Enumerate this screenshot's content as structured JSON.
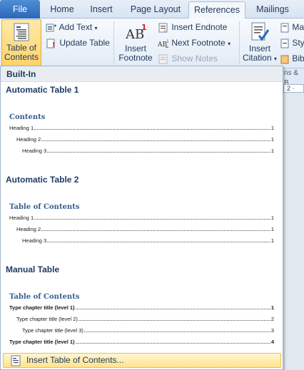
{
  "tabs": {
    "file": "File",
    "home": "Home",
    "insert": "Insert",
    "page_layout": "Page Layout",
    "references": "References",
    "mailings": "Mailings"
  },
  "ribbon": {
    "toc_line1": "Table of",
    "toc_line2": "Contents",
    "add_text": "Add Text",
    "update_table": "Update Table",
    "insert_footnote_1": "Insert",
    "insert_footnote_2": "Footnote",
    "insert_endnote": "Insert Endnote",
    "next_footnote": "Next Footnote",
    "show_notes": "Show Notes",
    "insert_citation_1": "Insert",
    "insert_citation_2": "Citation",
    "manage_partial": "Ma",
    "style_partial": "Sty",
    "bibliography_partial": "Bib",
    "group_partial": "ns & B"
  },
  "ruler": {
    "mark": "2 ·"
  },
  "panel": {
    "header": "Built-In",
    "auto1": {
      "title": "Automatic Table 1",
      "preview_title": "Contents",
      "lines": [
        {
          "label": "Heading 1",
          "page": "1"
        },
        {
          "label": "Heading 2",
          "page": "1"
        },
        {
          "label": "Heading 3",
          "page": "1"
        }
      ]
    },
    "auto2": {
      "title": "Automatic Table 2",
      "preview_title": "Table of Contents",
      "lines": [
        {
          "label": "Heading 1",
          "page": "1"
        },
        {
          "label": "Heading 2",
          "page": "1"
        },
        {
          "label": "Heading 3",
          "page": "1"
        }
      ]
    },
    "manual": {
      "title": "Manual Table",
      "preview_title": "Table of Contents",
      "lines": [
        {
          "label": "Type chapter title (level 1)",
          "page": "1"
        },
        {
          "label": "Type chapter title (level 2)",
          "page": "2"
        },
        {
          "label": "Type chapter title (level 3)",
          "page": "3"
        },
        {
          "label": "Type chapter title (level 1)",
          "page": "4"
        }
      ]
    },
    "insert_toc": "Insert Table of Contents..."
  },
  "colors": {
    "accent": "#2a67b6",
    "highlight": "#ffd36b",
    "heading_blue": "#365f91"
  }
}
